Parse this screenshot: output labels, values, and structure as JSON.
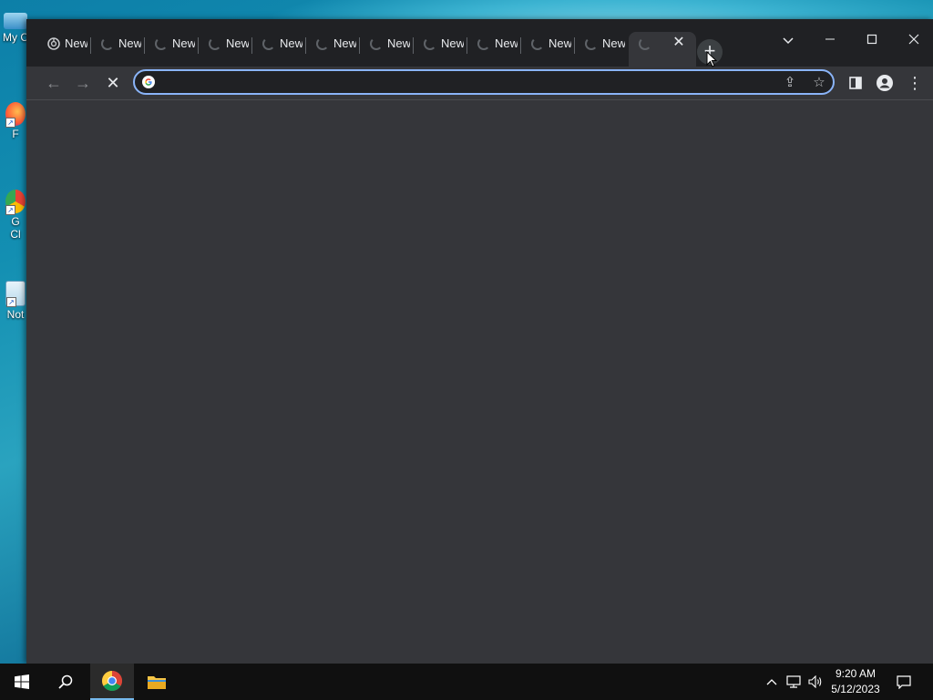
{
  "desktop": {
    "icons": [
      {
        "label": "My C",
        "name": "this-pc"
      },
      {
        "label": "F",
        "name": "firefox"
      },
      {
        "label": "G",
        "label2": "Cl",
        "name": "google-chrome"
      },
      {
        "label": "Not",
        "name": "notepad"
      }
    ]
  },
  "browser": {
    "tabs": [
      {
        "title": "New",
        "state": "chrome-favicon"
      },
      {
        "title": "New",
        "state": "loading"
      },
      {
        "title": "New",
        "state": "loading"
      },
      {
        "title": "New",
        "state": "loading"
      },
      {
        "title": "New",
        "state": "loading"
      },
      {
        "title": "New",
        "state": "loading"
      },
      {
        "title": "New",
        "state": "loading"
      },
      {
        "title": "New",
        "state": "loading"
      },
      {
        "title": "New",
        "state": "loading"
      },
      {
        "title": "New",
        "state": "loading"
      },
      {
        "title": "New",
        "state": "loading"
      },
      {
        "title": "",
        "state": "loading-active"
      }
    ],
    "new_tab_label": "+",
    "tab_search_icon": "chevron-down-icon",
    "window_controls": {
      "minimize": "—",
      "maximize": "☐",
      "close": "✕"
    },
    "toolbar": {
      "back": "←",
      "forward": "→",
      "stop": "✕",
      "omnibox": {
        "value": "",
        "placeholder": ""
      },
      "share": "⇪",
      "bookmark": "☆",
      "side_panel": "▮",
      "profile": "●",
      "menu": "⋮"
    },
    "accent_color": "#8ab4f8"
  },
  "taskbar": {
    "start": "windows-logo-icon",
    "search": "search-icon",
    "apps": [
      {
        "name": "google-chrome",
        "running": true
      },
      {
        "name": "file-explorer",
        "running": false
      }
    ],
    "tray": {
      "chevron": "^",
      "network": "network-icon",
      "volume": "volume-icon"
    },
    "clock": {
      "time": "9:20 AM",
      "date": "5/12/2023"
    },
    "notifications": "notification-icon"
  }
}
